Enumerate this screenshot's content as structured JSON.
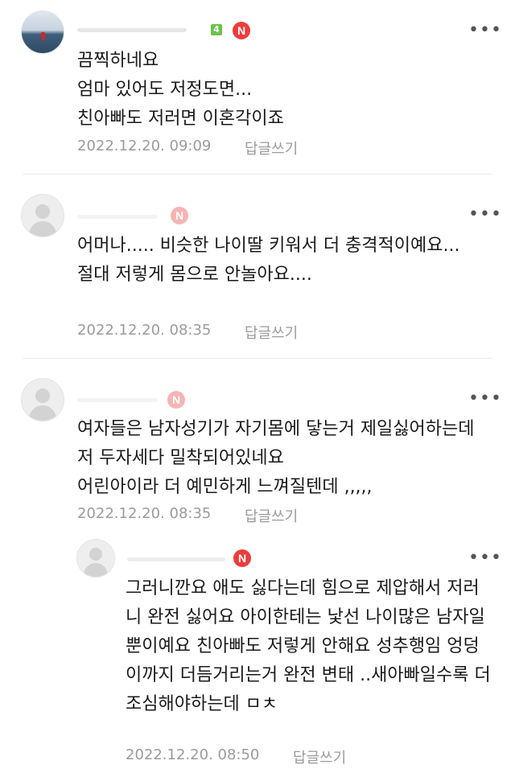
{
  "comments": [
    {
      "lines": [
        "끔찍하네요",
        "엄마 있어도 저정도면...",
        "친아빠도 저러면 이혼각이죠"
      ],
      "date": "2022.12.20. 09:09",
      "reply_label": "답글쓰기",
      "level_badge": "4",
      "n_badge": "N",
      "more_label": "•••"
    },
    {
      "lines": [
        "어머나..... 비슷한 나이딸 키워서 더 충격적이예요...",
        "절대 저렇게 몸으로 안놀아요...."
      ],
      "date": "2022.12.20. 08:35",
      "reply_label": "답글쓰기",
      "n_badge": "N",
      "more_label": "•••"
    },
    {
      "lines": [
        "여자들은 남자성기가 자기몸에 닿는거 제일싫어하는데 저 두자세다 밀착되어있네요",
        "어린아이라 더 예민하게 느껴질텐데 ,,,,,"
      ],
      "date": "2022.12.20. 08:35",
      "reply_label": "답글쓰기",
      "n_badge": "N",
      "more_label": "•••"
    },
    {
      "lines": [
        "그러니깐요 애도 싫다는데 힘으로 제압해서 저러니 완전 싫어요 아이한테는 낯선 나이많은 남자일뿐이예요 친아빠도 저렇게 안해요 성추행임 엉덩이까지 더듬거리는거 완전 변태 ..새아빠일수록 더 조심해야하는데 ㅁㅊ"
      ],
      "date": "2022.12.20. 08:50",
      "reply_label": "답글쓰기",
      "n_badge": "N",
      "more_label": "•••"
    }
  ]
}
